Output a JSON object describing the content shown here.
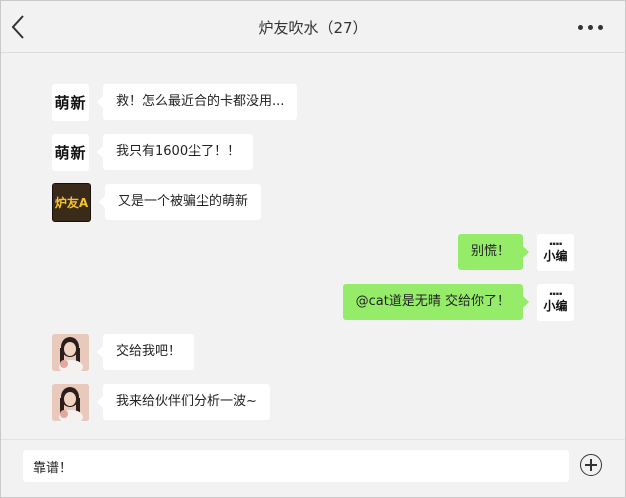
{
  "header": {
    "title": "炉友吹水（27）"
  },
  "icons": {
    "back": "chevron-left-icon",
    "more": "more-dots-icon",
    "add": "plus-circle-icon"
  },
  "colors": {
    "background": "#f2f2f2",
    "incoming_bubble": "#ffffff",
    "outgoing_bubble": "#95ec69"
  },
  "messages": [
    {
      "side": "left",
      "avatar_text": "萌新",
      "text": "救！怎么最近合的卡都没用..."
    },
    {
      "side": "left",
      "avatar_text": "萌新",
      "text": "我只有1600尘了！！"
    },
    {
      "side": "left",
      "avatar_text": "炉友A",
      "text": "又是一个被骗尘的萌新"
    },
    {
      "side": "right",
      "avatar_text": "小编",
      "text": "别慌！"
    },
    {
      "side": "right",
      "avatar_text": "小编",
      "text": "@cat道是无晴 交给你了！"
    },
    {
      "side": "left",
      "avatar_text": "",
      "text": "交给我吧！"
    },
    {
      "side": "left",
      "avatar_text": "",
      "text": "我来给伙伴们分析一波~"
    }
  ],
  "input": {
    "value": "靠谱！"
  }
}
